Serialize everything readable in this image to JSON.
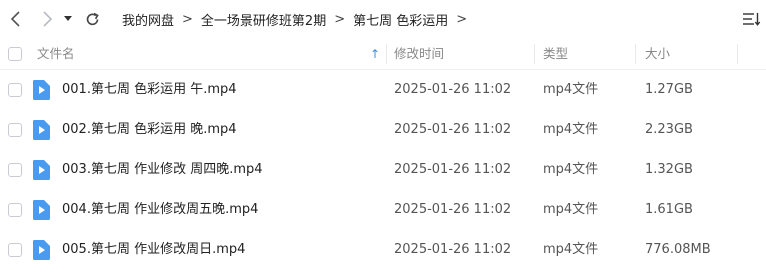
{
  "nav": {
    "back_icon": "chevron-left-icon",
    "forward_icon": "chevron-right-icon",
    "dropdown_icon": "caret-down-icon",
    "refresh_icon": "refresh-icon",
    "breadcrumb": [
      "我的网盘",
      "全一场景研修班第2期",
      "第七周 色彩运用"
    ],
    "separator": ">",
    "sort_menu_icon": "sort-list-icon"
  },
  "columns": {
    "name": "文件名",
    "modified": "修改时间",
    "type": "类型",
    "size": "大小",
    "sort_indicator": "↑"
  },
  "colors": {
    "accent": "#3a8ee6",
    "file_icon": "#4a9bf0"
  },
  "files": [
    {
      "name": "001.第七周 色彩运用 午.mp4",
      "modified": "2025-01-26 11:02",
      "type": "mp4文件",
      "size": "1.27GB"
    },
    {
      "name": "002.第七周 色彩运用 晚.mp4",
      "modified": "2025-01-26 11:02",
      "type": "mp4文件",
      "size": "2.23GB"
    },
    {
      "name": "003.第七周 作业修改 周四晚.mp4",
      "modified": "2025-01-26 11:02",
      "type": "mp4文件",
      "size": "1.32GB"
    },
    {
      "name": "004.第七周 作业修改周五晚.mp4",
      "modified": "2025-01-26 11:02",
      "type": "mp4文件",
      "size": "1.61GB"
    },
    {
      "name": "005.第七周 作业修改周日.mp4",
      "modified": "2025-01-26 11:02",
      "type": "mp4文件",
      "size": "776.08MB"
    }
  ]
}
